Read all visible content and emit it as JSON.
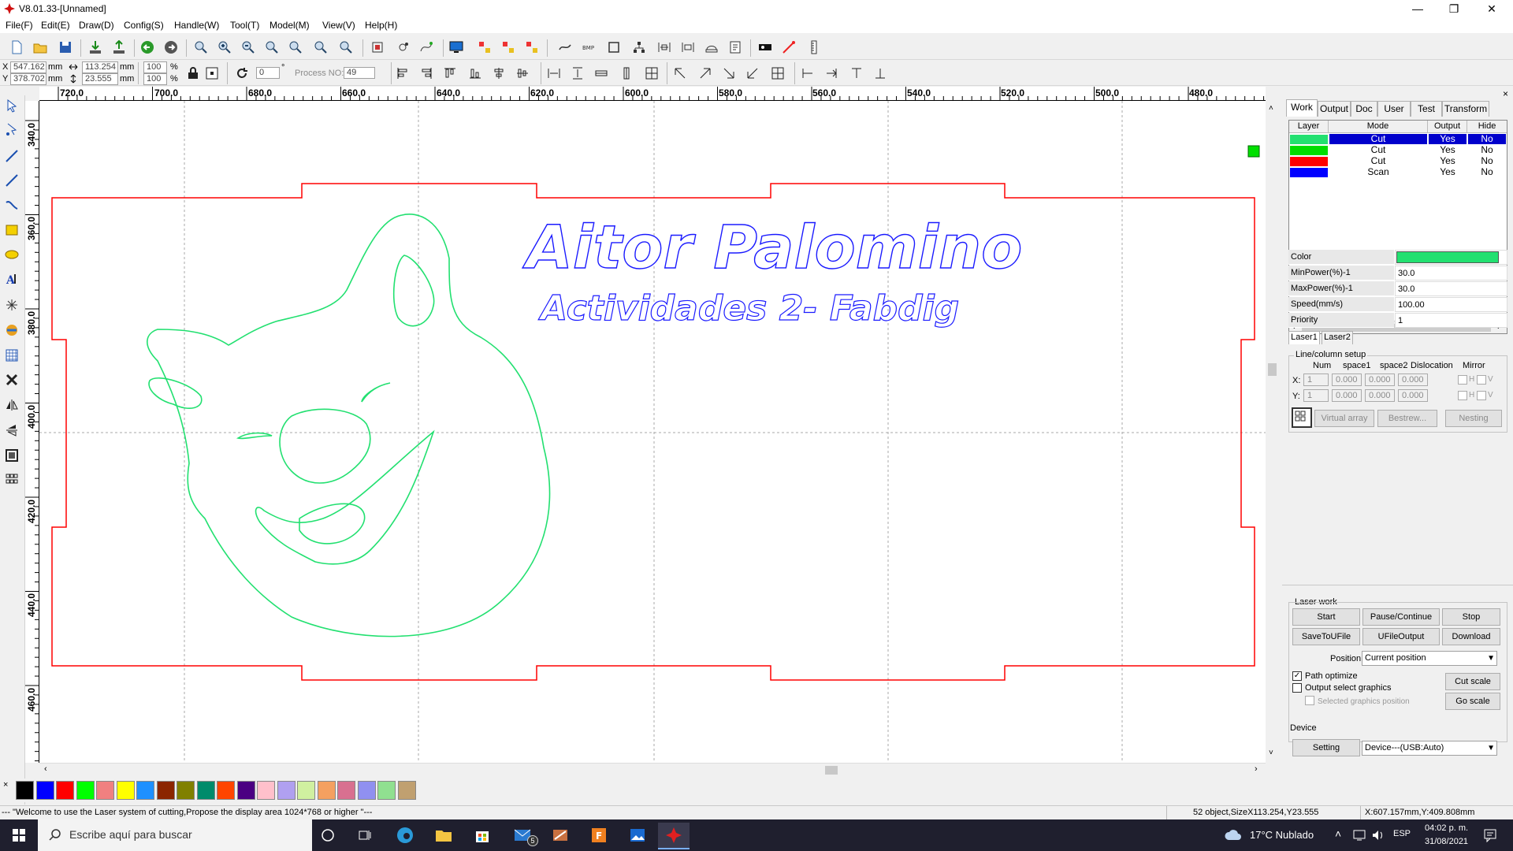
{
  "window": {
    "title": "V8.01.33-[Unnamed]",
    "minimize": "—",
    "maximize": "❐",
    "close": "✕"
  },
  "menu": [
    "File(F)",
    "Edit(E)",
    "Draw(D)",
    "Config(S)",
    "Handle(W)",
    "Tool(T)",
    "Model(M)",
    "View(V)",
    "Help(H)"
  ],
  "position_bar": {
    "x_label": "X",
    "y_label": "Y",
    "x_value": "547.162",
    "y_value": "378.702",
    "x_unit": "mm",
    "y_unit": "mm",
    "width_value": "113.254",
    "height_value": "23.555",
    "w_unit": "mm",
    "h_unit": "mm",
    "scale_x": "100",
    "scale_y": "100",
    "pct": "%",
    "rotation": "0",
    "deg": "°",
    "process_label": "Process NO:",
    "process_value": "49"
  },
  "ruler": {
    "h_labels": [
      "720.0",
      "700.0",
      "680.0",
      "660.0",
      "640.0",
      "620.0",
      "600.0",
      "580.0",
      "560.0",
      "540.0",
      "520.0",
      "500.0",
      "480.0"
    ],
    "v_labels": [
      "340.0",
      "360.0",
      "380.0",
      "400.0",
      "420.0",
      "440.0",
      "460.0"
    ]
  },
  "canvas": {
    "text_line1": "Aitor Palomino",
    "text_line2": "Actividades 2- Fabdig",
    "colors": {
      "cut_red": "#ff0000",
      "cut_green": "#22e070",
      "scan_blue": "#1a1aff"
    }
  },
  "palette": [
    "#000000",
    "#0000ff",
    "#ff0000",
    "#00ff00",
    "#f08080",
    "#ffff00",
    "#1e90ff",
    "#8b2500",
    "#808000",
    "#008b6b",
    "#ff4500",
    "#4b0082",
    "#ffc0cb",
    "#b0a0f0",
    "#d0f0a0",
    "#f4a060",
    "#d87090",
    "#9090f0",
    "#90e090",
    "#c0a070"
  ],
  "palette_close": "×",
  "status": {
    "message": "--- \"Welcome to use the Laser system of cutting,Propose the display area 1024*768 or higher \"---",
    "objects": "52 object,SizeX113.254,Y23.555",
    "cursor": "X:607.157mm,Y:409.808mm"
  },
  "panel": {
    "tabs": [
      "Work",
      "Output",
      "Doc",
      "User",
      "Test",
      "Transform"
    ],
    "table_headers": [
      "Layer",
      "Mode",
      "Output",
      "Hide"
    ],
    "layers": [
      {
        "color": "#22e070",
        "mode": "Cut",
        "output": "Yes",
        "hide": "No",
        "selected": true
      },
      {
        "color": "#00dd00",
        "mode": "Cut",
        "output": "Yes",
        "hide": "No",
        "selected": false
      },
      {
        "color": "#ff0000",
        "mode": "Cut",
        "output": "Yes",
        "hide": "No",
        "selected": false
      },
      {
        "color": "#0000ff",
        "mode": "Scan",
        "output": "Yes",
        "hide": "No",
        "selected": false
      }
    ],
    "props": [
      {
        "label": "Color",
        "value": ""
      },
      {
        "label": "MinPower(%)-1",
        "value": "30.0"
      },
      {
        "label": "MaxPower(%)-1",
        "value": "30.0"
      },
      {
        "label": "Speed(mm/s)",
        "value": "100.00"
      },
      {
        "label": "Priority",
        "value": "1"
      }
    ],
    "prop_color": "#22e070",
    "laser_tabs": [
      "Laser1",
      "Laser2"
    ],
    "linecol": {
      "title": "Line/column setup",
      "headers": [
        "Num",
        "space1",
        "space2",
        "Dislocation",
        "Mirror"
      ],
      "x_label": "X:",
      "y_label": "Y:",
      "x_values": [
        "1",
        "0.000",
        "0.000",
        "0.000"
      ],
      "y_values": [
        "1",
        "0.000",
        "0.000",
        "0.000"
      ],
      "h": "H",
      "v": "V",
      "buttons": [
        "Virtual array",
        "Bestrew...",
        "Nesting"
      ]
    },
    "laserwork": {
      "title": "Laser work",
      "buttons_row1": [
        "Start",
        "Pause/Continue",
        "Stop"
      ],
      "buttons_row2": [
        "SaveToUFile",
        "UFileOutput",
        "Download"
      ],
      "position_label": "Position:",
      "position_value": "Current position",
      "path_optimize": "Path optimize",
      "output_select": "Output select graphics",
      "selected_pos": "Selected graphics position",
      "cut_scale": "Cut scale",
      "go_scale": "Go scale"
    },
    "device": {
      "title": "Device",
      "setting": "Setting",
      "device_value": "Device---(USB:Auto)"
    }
  },
  "taskbar": {
    "search_placeholder": "Escribe aquí para buscar",
    "weather": "17°C  Nublado",
    "lang": "ESP",
    "time": "04:02 p. m.",
    "date": "31/08/2021",
    "mail_badge": "5"
  }
}
